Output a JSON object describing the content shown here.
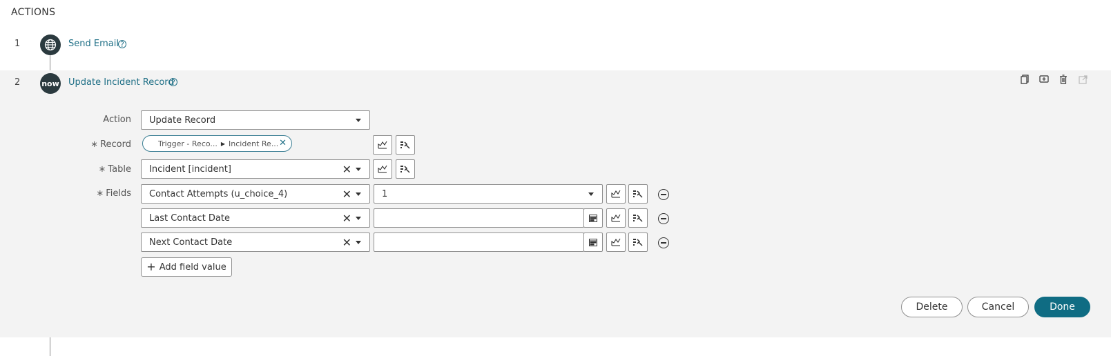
{
  "section": {
    "title": "ACTIONS"
  },
  "steps": [
    {
      "number": "1",
      "label": "Send Email",
      "icon": "globe-icon"
    },
    {
      "number": "2",
      "label": "Update Incident Record",
      "icon": "now-logo",
      "icon_text": "now"
    }
  ],
  "form": {
    "action": {
      "label": "Action",
      "value": "Update Record"
    },
    "record": {
      "label": "Record",
      "required_marker": "∗",
      "pill_part1": "Trigger - Reco...",
      "pill_part2": "Incident Re..."
    },
    "table": {
      "label": "Table",
      "required_marker": "∗",
      "value": "Incident [incident]"
    },
    "fields": {
      "label": "Fields",
      "required_marker": "∗",
      "rows": [
        {
          "name": "Contact Attempts (u_choice_4)",
          "value": "1"
        },
        {
          "name": "Last Contact Date",
          "value": ""
        },
        {
          "name": "Next Contact Date",
          "value": ""
        }
      ]
    },
    "add_field_label": "Add field value"
  },
  "footer": {
    "delete": "Delete",
    "cancel": "Cancel",
    "done": "Done"
  },
  "colors": {
    "accent": "#0f6c83",
    "link": "#1f6f86",
    "panel": "#f3f3f3"
  }
}
